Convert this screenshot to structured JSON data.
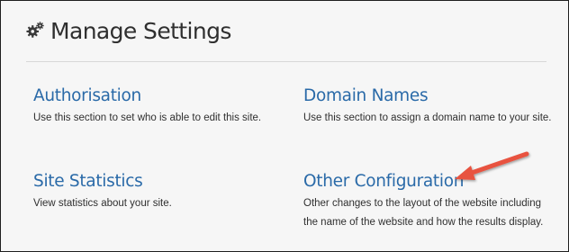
{
  "header": {
    "title": "Manage Settings",
    "icon": "gears-icon"
  },
  "sections": [
    {
      "title": "Authorisation",
      "description": "Use this section to set who is able to edit this site."
    },
    {
      "title": "Domain Names",
      "description": "Use this section to assign a domain name to your site."
    },
    {
      "title": "Site Statistics",
      "description": "View statistics about your site."
    },
    {
      "title": "Other Configuration",
      "description_lines": [
        "Other changes to the layout of the website including",
        "the name of the website and how the results display."
      ]
    }
  ],
  "annotation": {
    "icon": "arrow-pointer-icon",
    "color": "#e8533f"
  },
  "colors": {
    "link": "#2a6aa8",
    "text": "#2f2f2f",
    "background": "#f6f6f6"
  }
}
